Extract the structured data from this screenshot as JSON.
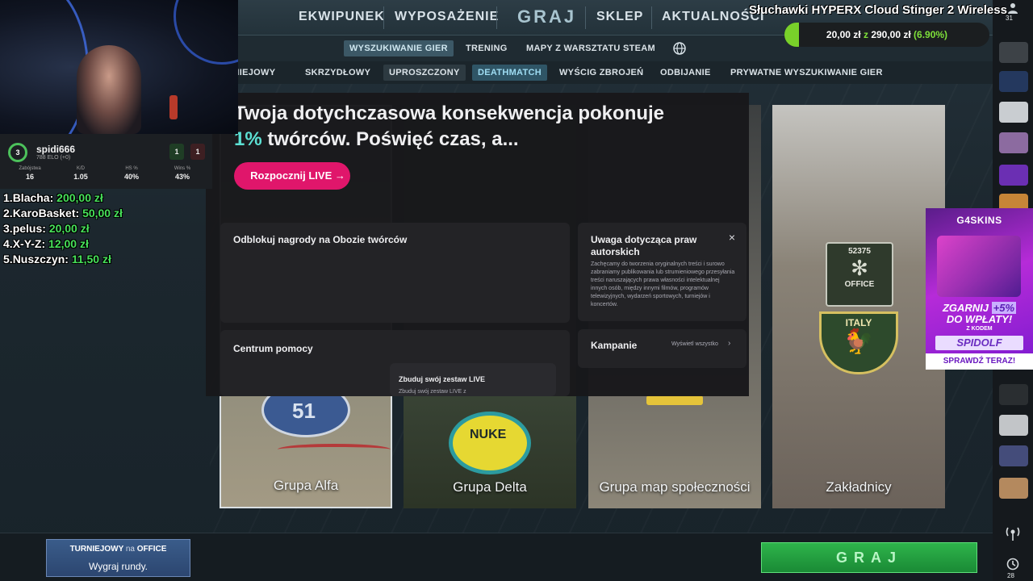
{
  "top_nav": {
    "items": [
      "EKWIPUNEK",
      "WYPOSAŻENIE",
      "GRAJ",
      "SKLEP",
      "AKTUALNOŚCI"
    ]
  },
  "sub_nav": {
    "items": [
      "WYSZUKIWANIE GIER",
      "TRENING",
      "MAPY Z WARSZTATU STEAM"
    ]
  },
  "mode_tabs": {
    "items": [
      "TURNIEJOWY",
      "SKRZYDŁOWY",
      "UPROSZCZONY",
      "DEATHMATCH",
      "WYŚCIG ZBROJEŃ",
      "ODBIJANIE",
      "PRYWATNE WYSZUKIWANIE GIER"
    ]
  },
  "map_groups": {
    "alfa": "Grupa Alfa",
    "delta": "Grupa Delta",
    "spol": "Grupa map społeczności",
    "zak": "Zakładnicy",
    "alfa_badge": "51",
    "delta_badge": "NUKE",
    "zak_badge_top": "52375",
    "zak_badge_office": "OFFICE",
    "zak_badge_italy": "ITALY"
  },
  "creator_overlay": {
    "headline_a": "Twoja dotychczasowa konsekwencja pokonuje ",
    "headline_pct": "1%",
    "headline_b": " twórców. Poświęć czas, a...",
    "live_button": "Rozpocznij LIVE →",
    "rewards_title": "Odblokuj nagrody na Obozie twórców",
    "copyright_title": "Uwaga dotycząca praw autorskich",
    "copyright_body": "Zachęcamy do tworzenia oryginalnych treści i surowo zabraniamy publikowania lub strumieniowego przesyłania treści naruszających prawa własności intelektualnej innych osób, między innymi filmów, programów telewizyjnych, wydarzeń sportowych, turniejów i koncertów.",
    "help_title": "Centrum pomocy",
    "campaigns_title": "Kampanie",
    "campaigns_link": "Wyświetl wszystko",
    "setup_title": "Zbuduj swój zestaw LIVE",
    "setup_body": "Zbuduj swój zestaw LIVE z",
    "close_glyph": "×"
  },
  "player_stats": {
    "name": "spidi666",
    "elo": "788 ELO (+0)",
    "level": "3",
    "wins_box": "1",
    "losses_box": "1",
    "stats": [
      {
        "k": "Zabójstwa",
        "v": "16"
      },
      {
        "k": "K/D",
        "v": "1.05"
      },
      {
        "k": "HS %",
        "v": "40%"
      },
      {
        "k": "Wins %",
        "v": "43%"
      }
    ]
  },
  "donations": [
    {
      "rank": "1.",
      "name": "Blacha:",
      "amount": "200,00 zł"
    },
    {
      "rank": "2.",
      "name": "KaroBasket:",
      "amount": "50,00 zł"
    },
    {
      "rank": "3.",
      "name": "pelus:",
      "amount": "20,00 zł"
    },
    {
      "rank": "4.",
      "name": "X-Y-Z:",
      "amount": "12,00 zł"
    },
    {
      "rank": "5.",
      "name": "Nuszczyn:",
      "amount": "11,50 zł"
    }
  ],
  "goal": {
    "title": "Słuchawki HYPERX Cloud Stinger 2 Wireless",
    "current": "20,00 zł",
    "sep": "z",
    "target": "290,00 zł",
    "percent_text": "(6.90%)",
    "fraction": 0.069
  },
  "ad": {
    "brand": "G4SKINS",
    "line1_a": "ZGARNIJ",
    "line1_b": "+5%",
    "line2": "DO WPŁATY!",
    "line3": "Z KODEM",
    "code": "SPIDOLF",
    "cta": "SPRAWDŹ TERAZ!"
  },
  "right_column": {
    "friends_count": "31",
    "bottom_count": "28"
  },
  "bottom": {
    "queue_mode": "TURNIEJOWY",
    "queue_na": "na",
    "queue_map": "OFFICE",
    "queue_sub": "Wygraj rundy.",
    "play": "GRAJ"
  },
  "colors": {
    "accent_green": "#47e15a",
    "twitch_pink": "#e0166b",
    "highlight_teal": "#5ce0d3"
  }
}
